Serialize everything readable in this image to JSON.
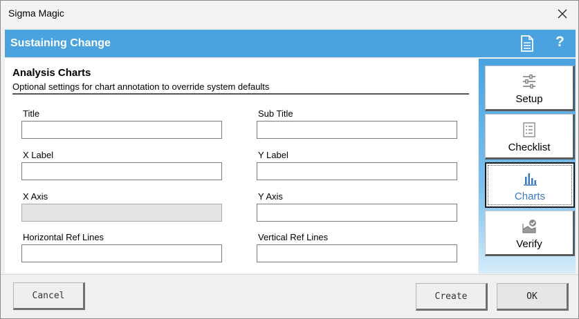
{
  "window": {
    "title": "Sigma Magic"
  },
  "banner": {
    "title": "Sustaining Change"
  },
  "section": {
    "heading": "Analysis Charts",
    "subheading": "Optional settings for chart annotation to override system defaults"
  },
  "fields": {
    "title": {
      "label": "Title",
      "value": ""
    },
    "subtitle": {
      "label": "Sub Title",
      "value": ""
    },
    "xlabel": {
      "label": "X Label",
      "value": ""
    },
    "ylabel": {
      "label": "Y Label",
      "value": ""
    },
    "xaxis": {
      "label": "X Axis",
      "value": ""
    },
    "yaxis": {
      "label": "Y Axis",
      "value": ""
    },
    "hreflines": {
      "label": "Horizontal Ref Lines",
      "value": ""
    },
    "vreflines": {
      "label": "Vertical Ref Lines",
      "value": ""
    }
  },
  "sidebar": {
    "items": [
      {
        "label": "Setup",
        "icon": "sliders-icon"
      },
      {
        "label": "Checklist",
        "icon": "checklist-icon"
      },
      {
        "label": "Charts",
        "icon": "bar-chart-icon",
        "active": true
      },
      {
        "label": "Verify",
        "icon": "verify-icon"
      }
    ]
  },
  "footer": {
    "cancel_label": "Cancel",
    "create_label": "Create",
    "ok_label": "OK"
  },
  "colors": {
    "banner": "#4aa3df",
    "active_label": "#3b78c2"
  }
}
